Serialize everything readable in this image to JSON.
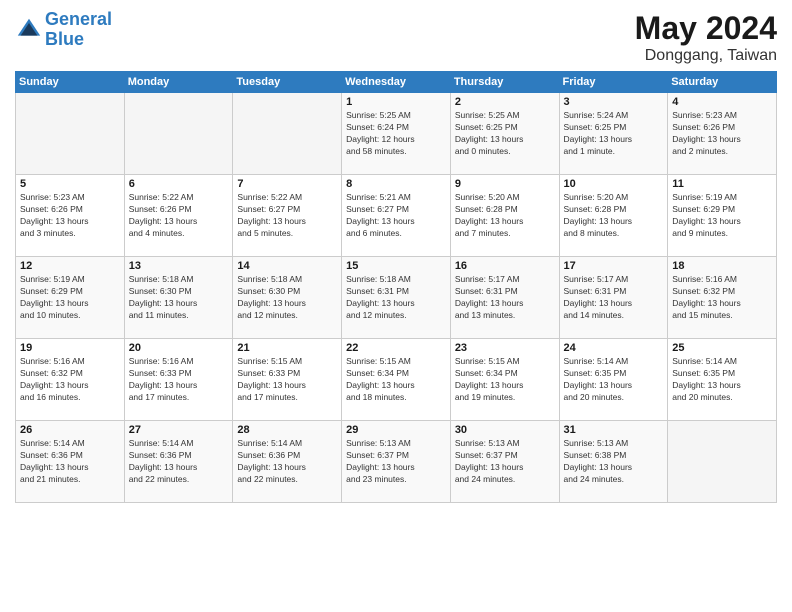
{
  "header": {
    "logo_line1": "General",
    "logo_line2": "Blue",
    "month": "May 2024",
    "location": "Donggang, Taiwan"
  },
  "weekdays": [
    "Sunday",
    "Monday",
    "Tuesday",
    "Wednesday",
    "Thursday",
    "Friday",
    "Saturday"
  ],
  "weeks": [
    [
      {
        "day": "",
        "info": ""
      },
      {
        "day": "",
        "info": ""
      },
      {
        "day": "",
        "info": ""
      },
      {
        "day": "1",
        "info": "Sunrise: 5:25 AM\nSunset: 6:24 PM\nDaylight: 12 hours\nand 58 minutes."
      },
      {
        "day": "2",
        "info": "Sunrise: 5:25 AM\nSunset: 6:25 PM\nDaylight: 13 hours\nand 0 minutes."
      },
      {
        "day": "3",
        "info": "Sunrise: 5:24 AM\nSunset: 6:25 PM\nDaylight: 13 hours\nand 1 minute."
      },
      {
        "day": "4",
        "info": "Sunrise: 5:23 AM\nSunset: 6:26 PM\nDaylight: 13 hours\nand 2 minutes."
      }
    ],
    [
      {
        "day": "5",
        "info": "Sunrise: 5:23 AM\nSunset: 6:26 PM\nDaylight: 13 hours\nand 3 minutes."
      },
      {
        "day": "6",
        "info": "Sunrise: 5:22 AM\nSunset: 6:26 PM\nDaylight: 13 hours\nand 4 minutes."
      },
      {
        "day": "7",
        "info": "Sunrise: 5:22 AM\nSunset: 6:27 PM\nDaylight: 13 hours\nand 5 minutes."
      },
      {
        "day": "8",
        "info": "Sunrise: 5:21 AM\nSunset: 6:27 PM\nDaylight: 13 hours\nand 6 minutes."
      },
      {
        "day": "9",
        "info": "Sunrise: 5:20 AM\nSunset: 6:28 PM\nDaylight: 13 hours\nand 7 minutes."
      },
      {
        "day": "10",
        "info": "Sunrise: 5:20 AM\nSunset: 6:28 PM\nDaylight: 13 hours\nand 8 minutes."
      },
      {
        "day": "11",
        "info": "Sunrise: 5:19 AM\nSunset: 6:29 PM\nDaylight: 13 hours\nand 9 minutes."
      }
    ],
    [
      {
        "day": "12",
        "info": "Sunrise: 5:19 AM\nSunset: 6:29 PM\nDaylight: 13 hours\nand 10 minutes."
      },
      {
        "day": "13",
        "info": "Sunrise: 5:18 AM\nSunset: 6:30 PM\nDaylight: 13 hours\nand 11 minutes."
      },
      {
        "day": "14",
        "info": "Sunrise: 5:18 AM\nSunset: 6:30 PM\nDaylight: 13 hours\nand 12 minutes."
      },
      {
        "day": "15",
        "info": "Sunrise: 5:18 AM\nSunset: 6:31 PM\nDaylight: 13 hours\nand 12 minutes."
      },
      {
        "day": "16",
        "info": "Sunrise: 5:17 AM\nSunset: 6:31 PM\nDaylight: 13 hours\nand 13 minutes."
      },
      {
        "day": "17",
        "info": "Sunrise: 5:17 AM\nSunset: 6:31 PM\nDaylight: 13 hours\nand 14 minutes."
      },
      {
        "day": "18",
        "info": "Sunrise: 5:16 AM\nSunset: 6:32 PM\nDaylight: 13 hours\nand 15 minutes."
      }
    ],
    [
      {
        "day": "19",
        "info": "Sunrise: 5:16 AM\nSunset: 6:32 PM\nDaylight: 13 hours\nand 16 minutes."
      },
      {
        "day": "20",
        "info": "Sunrise: 5:16 AM\nSunset: 6:33 PM\nDaylight: 13 hours\nand 17 minutes."
      },
      {
        "day": "21",
        "info": "Sunrise: 5:15 AM\nSunset: 6:33 PM\nDaylight: 13 hours\nand 17 minutes."
      },
      {
        "day": "22",
        "info": "Sunrise: 5:15 AM\nSunset: 6:34 PM\nDaylight: 13 hours\nand 18 minutes."
      },
      {
        "day": "23",
        "info": "Sunrise: 5:15 AM\nSunset: 6:34 PM\nDaylight: 13 hours\nand 19 minutes."
      },
      {
        "day": "24",
        "info": "Sunrise: 5:14 AM\nSunset: 6:35 PM\nDaylight: 13 hours\nand 20 minutes."
      },
      {
        "day": "25",
        "info": "Sunrise: 5:14 AM\nSunset: 6:35 PM\nDaylight: 13 hours\nand 20 minutes."
      }
    ],
    [
      {
        "day": "26",
        "info": "Sunrise: 5:14 AM\nSunset: 6:36 PM\nDaylight: 13 hours\nand 21 minutes."
      },
      {
        "day": "27",
        "info": "Sunrise: 5:14 AM\nSunset: 6:36 PM\nDaylight: 13 hours\nand 22 minutes."
      },
      {
        "day": "28",
        "info": "Sunrise: 5:14 AM\nSunset: 6:36 PM\nDaylight: 13 hours\nand 22 minutes."
      },
      {
        "day": "29",
        "info": "Sunrise: 5:13 AM\nSunset: 6:37 PM\nDaylight: 13 hours\nand 23 minutes."
      },
      {
        "day": "30",
        "info": "Sunrise: 5:13 AM\nSunset: 6:37 PM\nDaylight: 13 hours\nand 24 minutes."
      },
      {
        "day": "31",
        "info": "Sunrise: 5:13 AM\nSunset: 6:38 PM\nDaylight: 13 hours\nand 24 minutes."
      },
      {
        "day": "",
        "info": ""
      }
    ]
  ]
}
